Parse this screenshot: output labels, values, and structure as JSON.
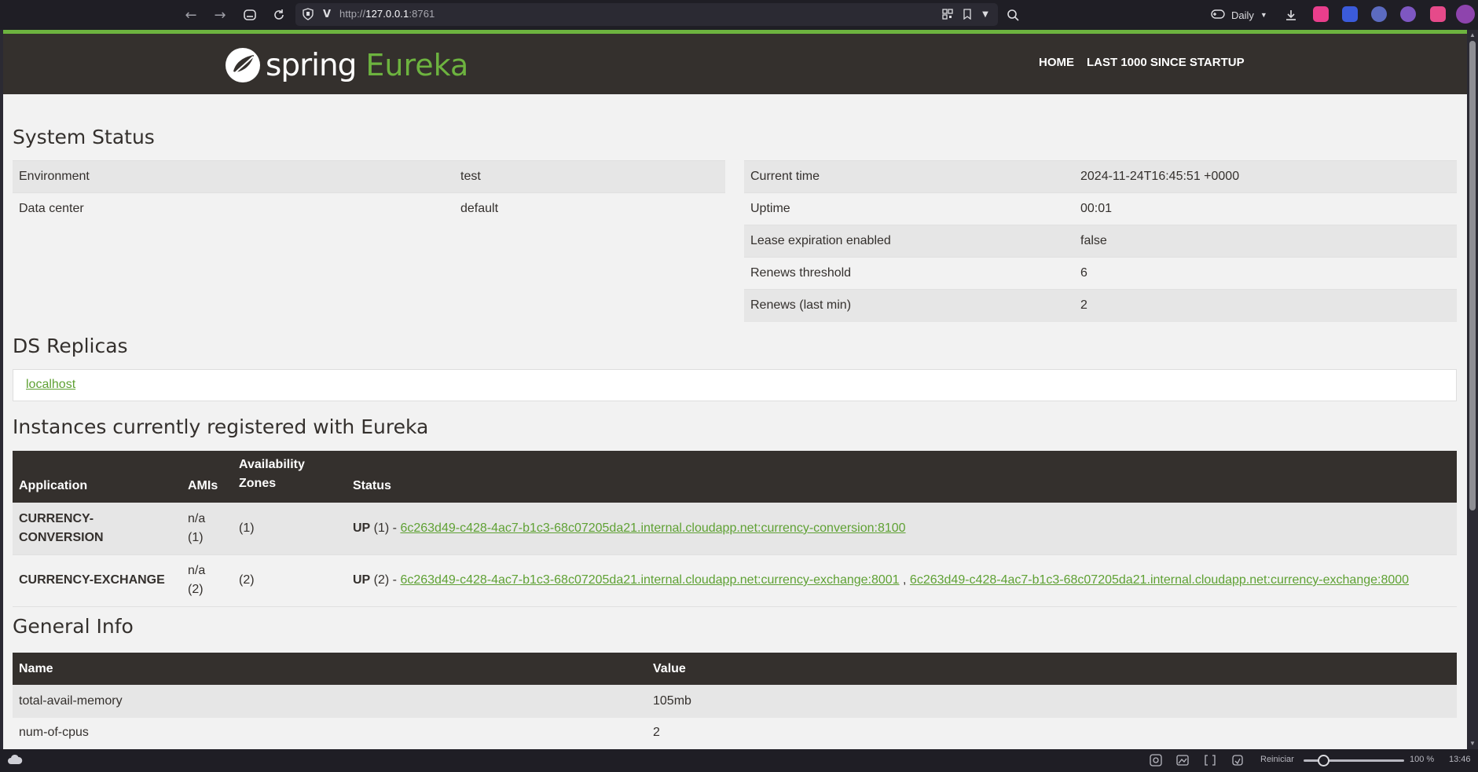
{
  "browser": {
    "url_prefix": "http://",
    "url_host": "127.0.0.1",
    "url_port": ":8761",
    "profile_label": "Daily",
    "zoom": "100 %",
    "clock": "13:46",
    "reset_label": "Reiniciar"
  },
  "nav": {
    "logo_spring": "spring",
    "logo_eureka": "Eureka",
    "home": "HOME",
    "last1000": "LAST 1000 SINCE STARTUP"
  },
  "system_status": {
    "title": "System Status",
    "left": [
      {
        "key": "Environment",
        "value": "test"
      },
      {
        "key": "Data center",
        "value": "default"
      }
    ],
    "right": [
      {
        "key": "Current time",
        "value": "2024-11-24T16:45:51 +0000"
      },
      {
        "key": "Uptime",
        "value": "00:01"
      },
      {
        "key": "Lease expiration enabled",
        "value": "false"
      },
      {
        "key": "Renews threshold",
        "value": "6"
      },
      {
        "key": "Renews (last min)",
        "value": "2"
      }
    ]
  },
  "ds_replicas": {
    "title": "DS Replicas",
    "link": "localhost"
  },
  "instances": {
    "title": "Instances currently registered with Eureka",
    "headers": [
      "Application",
      "AMIs",
      "Availability Zones",
      "Status"
    ],
    "rows": [
      {
        "app": "CURRENCY-CONVERSION",
        "amis": "n/a (1)",
        "zones": "(1)",
        "status_prefix": "UP",
        "status_count": " (1) - ",
        "links": [
          "6c263d49-c428-4ac7-b1c3-68c07205da21.internal.cloudapp.net:currency-conversion:8100"
        ]
      },
      {
        "app": "CURRENCY-EXCHANGE",
        "amis": "n/a (2)",
        "zones": "(2)",
        "status_prefix": "UP",
        "status_count": " (2) - ",
        "links": [
          "6c263d49-c428-4ac7-b1c3-68c07205da21.internal.cloudapp.net:currency-exchange:8001",
          "6c263d49-c428-4ac7-b1c3-68c07205da21.internal.cloudapp.net:currency-exchange:8000"
        ]
      }
    ]
  },
  "general_info": {
    "title": "General Info",
    "headers": [
      "Name",
      "Value"
    ],
    "rows": [
      {
        "name": "total-avail-memory",
        "value": "105mb"
      },
      {
        "name": "num-of-cpus",
        "value": "2"
      }
    ]
  }
}
